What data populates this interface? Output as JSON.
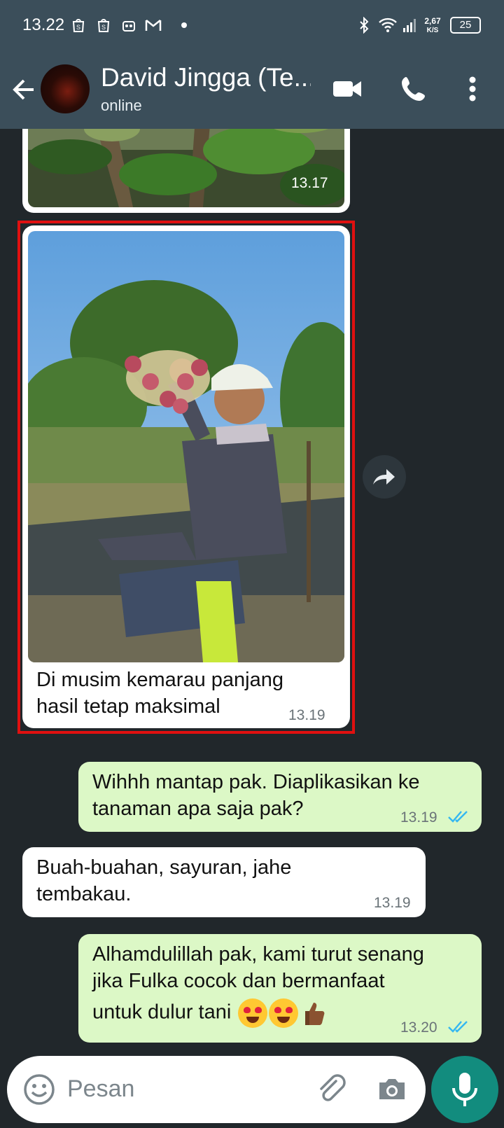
{
  "status_bar": {
    "time": "13.22",
    "network_speed_value": "2,67",
    "network_speed_unit": "K/S",
    "battery": "25"
  },
  "header": {
    "contact_name": "David Jingga (Te...",
    "contact_status": "online"
  },
  "messages": [
    {
      "direction": "incoming",
      "type": "image",
      "time": "13.17"
    },
    {
      "direction": "incoming",
      "type": "image",
      "caption_line1": "Di musim kemarau panjang",
      "caption_line2": "hasil tetap maksimal",
      "time": "13.19"
    },
    {
      "direction": "outgoing",
      "text_line1": "Wihhh mantap pak. Diaplikasikan ke",
      "text_line2": "tanaman apa saja pak?",
      "time": "13.19"
    },
    {
      "direction": "incoming",
      "text_line1": "Buah-buahan, sayuran, jahe",
      "text_line2": "tembakau.",
      "time": "13.19"
    },
    {
      "direction": "outgoing",
      "text_line1": "Alhamdulillah pak, kami turut senang",
      "text_line2": "jika Fulka cocok dan bermanfaat",
      "text_line3": "untuk dulur tani",
      "time": "13.20"
    }
  ],
  "input": {
    "placeholder": "Pesan"
  },
  "colors": {
    "header_bg": "#3b4e5a",
    "chat_bg": "#21272b",
    "outgoing_bubble": "#dcf8c6",
    "incoming_bubble": "#ffffff",
    "read_ticks": "#34b7f1",
    "mic_button": "#128c7e",
    "highlight_border": "#e01010"
  },
  "icons": [
    "back-arrow-icon",
    "video-call-icon",
    "phone-icon",
    "more-vert-icon",
    "forward-icon",
    "emoji-icon",
    "attach-icon",
    "camera-icon",
    "mic-icon",
    "bluetooth-icon",
    "wifi-icon",
    "signal-icon",
    "battery-icon",
    "shopee-icon",
    "gmail-icon"
  ]
}
